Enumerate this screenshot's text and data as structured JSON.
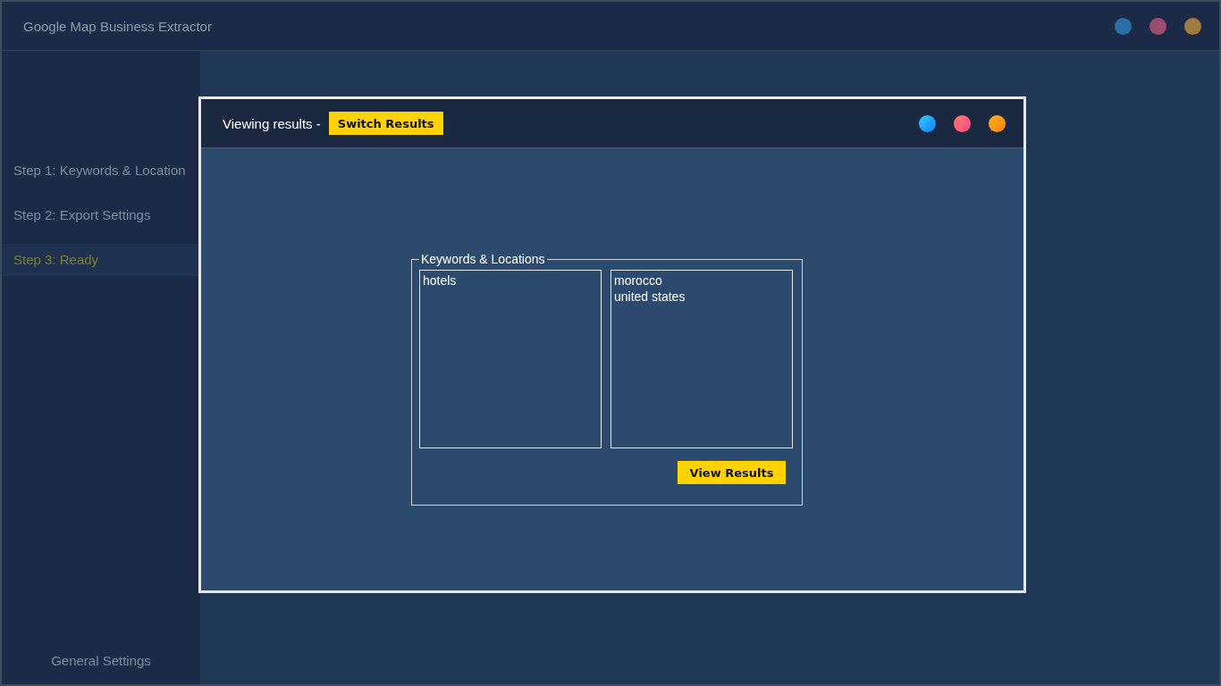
{
  "window": {
    "title": "Google Map Business Extractor"
  },
  "sidebar": {
    "items": [
      {
        "label": "Step 1: Keywords & Location",
        "selected": false
      },
      {
        "label": "Step 2: Export Settings",
        "selected": false
      },
      {
        "label": "Step 3: Ready",
        "selected": true
      }
    ],
    "footer": "General Settings"
  },
  "dialog": {
    "title": "Viewing results -",
    "switch_button": "Switch Results",
    "group": {
      "legend": "Keywords & Locations",
      "keywords": [
        "hotels"
      ],
      "locations": [
        "morocco",
        "united states"
      ],
      "button": "View Results"
    }
  }
}
